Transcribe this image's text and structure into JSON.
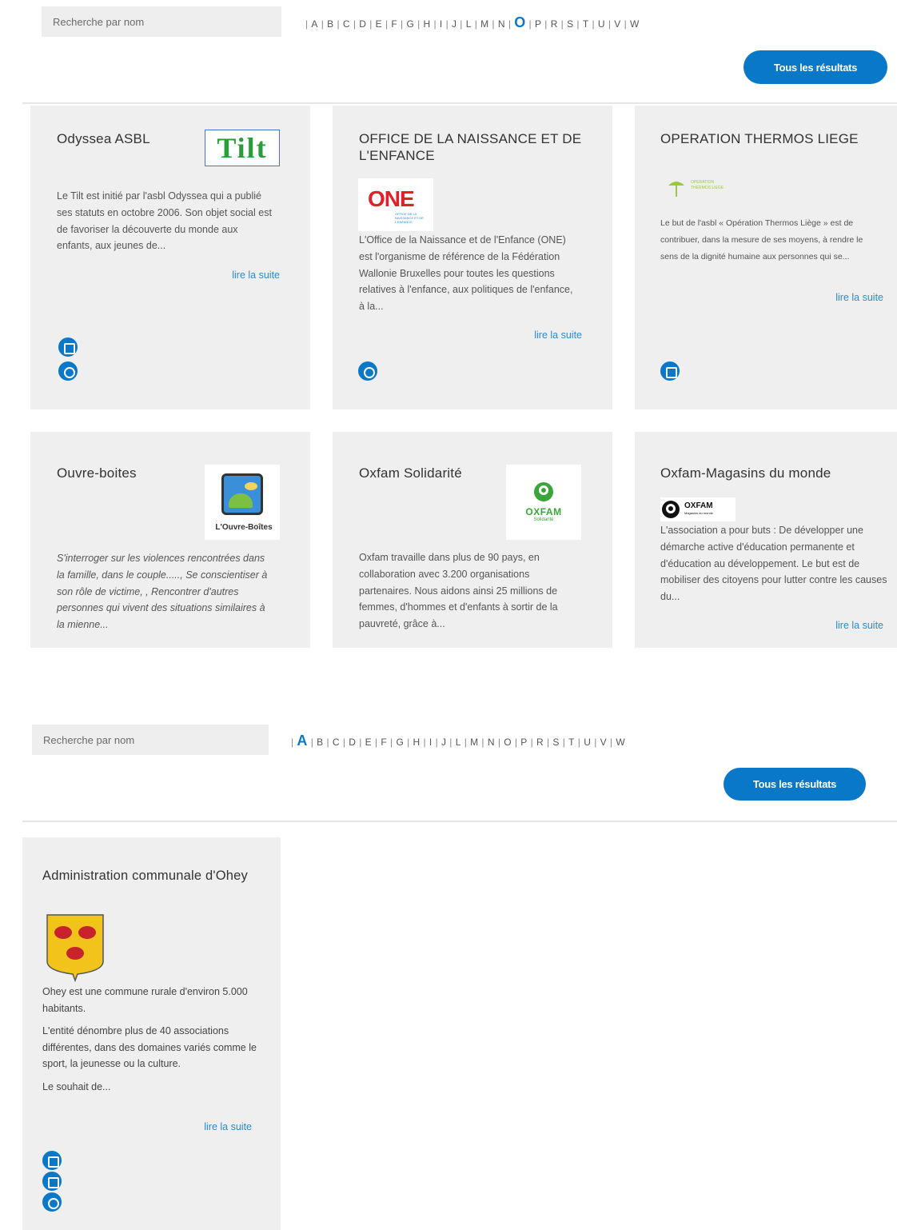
{
  "top": {
    "search_placeholder": "Recherche par nom",
    "letters": [
      "A",
      "B",
      "C",
      "D",
      "E",
      "F",
      "G",
      "H",
      "I",
      "J",
      "L",
      "M",
      "N",
      "O",
      "P",
      "R",
      "S",
      "T",
      "U",
      "V",
      "W"
    ],
    "active_letter": "O",
    "all_results_label": "Tous les résultats"
  },
  "cards": [
    {
      "title": "Odyssea ASBL",
      "logo_text": "Tilt",
      "description": "Le Tilt est initié par l'asbl Odyssea qui a publié ses statuts en octobre 2006. Son objet social est de favoriser la découverte du monde aux enfants, aux jeunes de...",
      "read_more": "lire la suite"
    },
    {
      "title": "OFFICE DE LA NAISSANCE ET DE L'ENFANCE",
      "logo_text": "ONE",
      "logo_subtext": "OFFICE DE LA NAISSANCE ET DE L'ENFANCE",
      "description": "L'Office de la Naissance et de l'Enfance (ONE) est l'organisme de référence de la Fédération Wallonie Bruxelles pour toutes les questions relatives à l'enfance, aux politiques de l'enfance, à la...",
      "read_more": "lire la suite"
    },
    {
      "title": "OPERATION THERMOS LIEGE",
      "logo_text": "OPERATION THERMOS LIEGE",
      "description": "Le but de l'asbl « Opération Thermos Liège » est de contribuer, dans la mesure de ses moyens, à rendre le sens de la dignité humaine aux personnes qui se...",
      "read_more": "lire la suite"
    },
    {
      "title": "Ouvre-boites",
      "logo_text": "L'Ouvre-Boîtes",
      "description": "S'interroger sur les violences rencontrées dans la famille, dans le couple....., Se conscientiser à son rôle de victime, , Rencontrer d'autres personnes qui vivent des situations similaires à la mienne..."
    },
    {
      "title": "Oxfam Solidarité",
      "logo_text": "OXFAM",
      "logo_subtext": "Solidarité",
      "description": "Oxfam travaille dans plus de 90 pays, en collaboration avec 3.200 organisations partenaires. Nous aidons ainsi 25 millions de femmes, d'hommes et d'enfants à sortir de la pauvreté, grâce à..."
    },
    {
      "title": "Oxfam-Magasins du monde",
      "logo_text": "OXFAM",
      "logo_subtext": "Magasins du monde",
      "description": "L'association a pour buts : De développer une démarche active d'éducation permanente et d'éducation au développement. Le but est de mobiliser des citoyens pour lutter contre les causes du...",
      "read_more": "lire la suite"
    }
  ],
  "bottom": {
    "search_placeholder": "Recherche par nom",
    "letters": [
      "A",
      "B",
      "C",
      "D",
      "E",
      "F",
      "G",
      "H",
      "I",
      "J",
      "L",
      "M",
      "N",
      "O",
      "P",
      "R",
      "S",
      "T",
      "U",
      "V",
      "W"
    ],
    "active_letter": "A",
    "all_results_label": "Tous les résultats",
    "card": {
      "title": "Administration communale d'Ohey",
      "paragraphs": [
        "Ohey est une commune rurale d'environ 5.000 habitants.",
        "L'entité dénombre plus de 40 associations différentes, dans des domaines variés comme le sport, la jeunesse ou la culture.",
        "Le souhait de..."
      ],
      "read_more": "lire la suite"
    }
  },
  "colors": {
    "accent": "#0a78c8",
    "card_bg": "#efefef",
    "link": "#2a8ad2"
  }
}
